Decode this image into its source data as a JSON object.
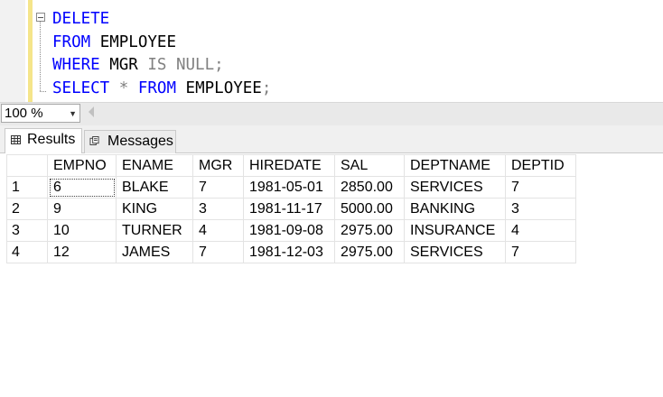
{
  "editor": {
    "lines": [
      [
        {
          "t": "DELETE",
          "k": "kw"
        }
      ],
      [
        {
          "t": "FROM",
          "k": "kw"
        },
        {
          "t": " EMPLOYEE",
          "k": "id"
        }
      ],
      [
        {
          "t": "WHERE",
          "k": "kw"
        },
        {
          "t": " MGR ",
          "k": "id"
        },
        {
          "t": "IS NULL",
          "k": "op"
        },
        {
          "t": ";",
          "k": "op"
        }
      ],
      [
        {
          "t": "SELECT",
          "k": "kw"
        },
        {
          "t": " ",
          "k": "id"
        },
        {
          "t": "*",
          "k": "op"
        },
        {
          "t": " ",
          "k": "id"
        },
        {
          "t": "FROM",
          "k": "kw"
        },
        {
          "t": " EMPLOYEE",
          "k": "id"
        },
        {
          "t": ";",
          "k": "op"
        }
      ]
    ],
    "colors": {
      "keyword": "#0000ff",
      "operator": "#808080",
      "identifier": "#000000"
    }
  },
  "zoom": {
    "value": "100 %"
  },
  "tabs": {
    "results": {
      "label": "Results",
      "icon": "grid-icon"
    },
    "messages": {
      "label": "Messages",
      "icon": "messages-icon"
    }
  },
  "grid": {
    "columns": [
      "EMPNO",
      "ENAME",
      "MGR",
      "HIREDATE",
      "SAL",
      "DEPTNAME",
      "DEPTID"
    ],
    "rows": [
      {
        "num": "1",
        "cells": [
          "6",
          "BLAKE",
          "7",
          "1981-05-01",
          "2850.00",
          "SERVICES",
          "7"
        ]
      },
      {
        "num": "2",
        "cells": [
          "9",
          "KING",
          "3",
          "1981-11-17",
          "5000.00",
          "BANKING",
          "3"
        ]
      },
      {
        "num": "3",
        "cells": [
          "10",
          "TURNER",
          "4",
          "1981-09-08",
          "2975.00",
          "INSURANCE",
          "4"
        ]
      },
      {
        "num": "4",
        "cells": [
          "12",
          "JAMES",
          "7",
          "1981-12-03",
          "2975.00",
          "SERVICES",
          "7"
        ]
      }
    ]
  }
}
